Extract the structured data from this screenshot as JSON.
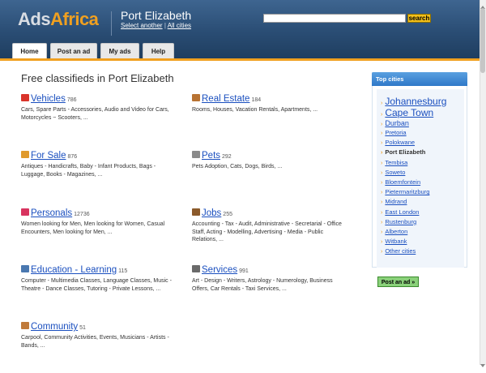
{
  "header": {
    "logo_part1": "Ads",
    "logo_part2": "Africa",
    "city": "Port Elizabeth",
    "select_another": "Select another",
    "separator": " | ",
    "all_cities": "All cities",
    "search_value": "",
    "search_button": "search"
  },
  "tabs": [
    {
      "label": "Home"
    },
    {
      "label": "Post an ad"
    },
    {
      "label": "My ads"
    },
    {
      "label": "Help"
    }
  ],
  "main": {
    "title": "Free classifieds in Port Elizabeth",
    "categories": [
      {
        "name": "Vehicles",
        "count": "786",
        "desc": "Cars, Spare Parts - Accessories, Audio and Video for Cars, Motorcycles ~ Scooters, ...",
        "icon": "car-icon",
        "color": "#d9342b"
      },
      {
        "name": "Real Estate",
        "count": "184",
        "desc": "Rooms, Houses, Vacation Rentals, Apartments, ...",
        "icon": "house-icon",
        "color": "#b87333"
      },
      {
        "name": "For Sale",
        "count": "876",
        "desc": "Antiques - Handicrafts, Baby - Infant Products, Bags - Luggage, Books - Magazines, ...",
        "icon": "box-icon",
        "color": "#e09a2c"
      },
      {
        "name": "Pets",
        "count": "292",
        "desc": "Pets Adoption, Cats, Dogs, Birds, ...",
        "icon": "paw-icon",
        "color": "#8a8a8a"
      },
      {
        "name": "Personals",
        "count": "12736",
        "desc": "Women looking for Men, Men looking for Women, Casual Encounters, Men looking for Men, ...",
        "icon": "heart-icon",
        "color": "#d8345f"
      },
      {
        "name": "Jobs",
        "count": "255",
        "desc": "Accounting - Tax - Audit, Administrative - Secretarial - Office Staff, Acting - Modelling, Advertising - Media - Public Relations, ...",
        "icon": "briefcase-icon",
        "color": "#8b5a2b"
      },
      {
        "name": "Education - Learning",
        "count": "115",
        "desc": "Computer - Multimedia Classes, Language Classes, Music - Theatre - Dance Classes, Tutoring - Private Lessons, ...",
        "icon": "book-icon",
        "color": "#4a78b0"
      },
      {
        "name": "Services",
        "count": "991",
        "desc": "Art - Design - Writers, Astrology - Numerology, Business Offers, Car Rentals - Taxi Services, ...",
        "icon": "tools-icon",
        "color": "#6a6a6a"
      },
      {
        "name": "Community",
        "count": "51",
        "desc": "Carpool, Community Activities, Events, Musicians - Artists - Bands, ...",
        "icon": "people-icon",
        "color": "#c07a3a"
      }
    ]
  },
  "sidebar": {
    "title": "Top cities",
    "cities": [
      {
        "name": "Johannesburg",
        "size": "large",
        "current": false
      },
      {
        "name": "Cape Town",
        "size": "large",
        "current": false
      },
      {
        "name": "Durban",
        "size": "medium",
        "current": false
      },
      {
        "name": "Pretoria",
        "size": "small",
        "current": false
      },
      {
        "name": "Polokwane",
        "size": "small",
        "current": false
      },
      {
        "name": "Port Elizabeth",
        "size": "small",
        "current": true
      },
      {
        "name": "Tembisa",
        "size": "small",
        "current": false
      },
      {
        "name": "Soweto",
        "size": "small",
        "current": false
      },
      {
        "name": "Bloemfontein",
        "size": "small",
        "current": false
      },
      {
        "name": "Pietermaritzburg",
        "size": "small",
        "current": false
      },
      {
        "name": "Midrand",
        "size": "small",
        "current": false
      },
      {
        "name": "East London",
        "size": "small",
        "current": false
      },
      {
        "name": "Rustenburg",
        "size": "small",
        "current": false
      },
      {
        "name": "Alberton",
        "size": "small",
        "current": false
      },
      {
        "name": "Witbank",
        "size": "small",
        "current": false
      },
      {
        "name": "Other cities",
        "size": "small",
        "current": false
      }
    ],
    "post_button": "Post an ad »"
  },
  "colors": {
    "accent": "#f0a020",
    "link": "#1a4fbf",
    "header": "#2a4d74"
  }
}
